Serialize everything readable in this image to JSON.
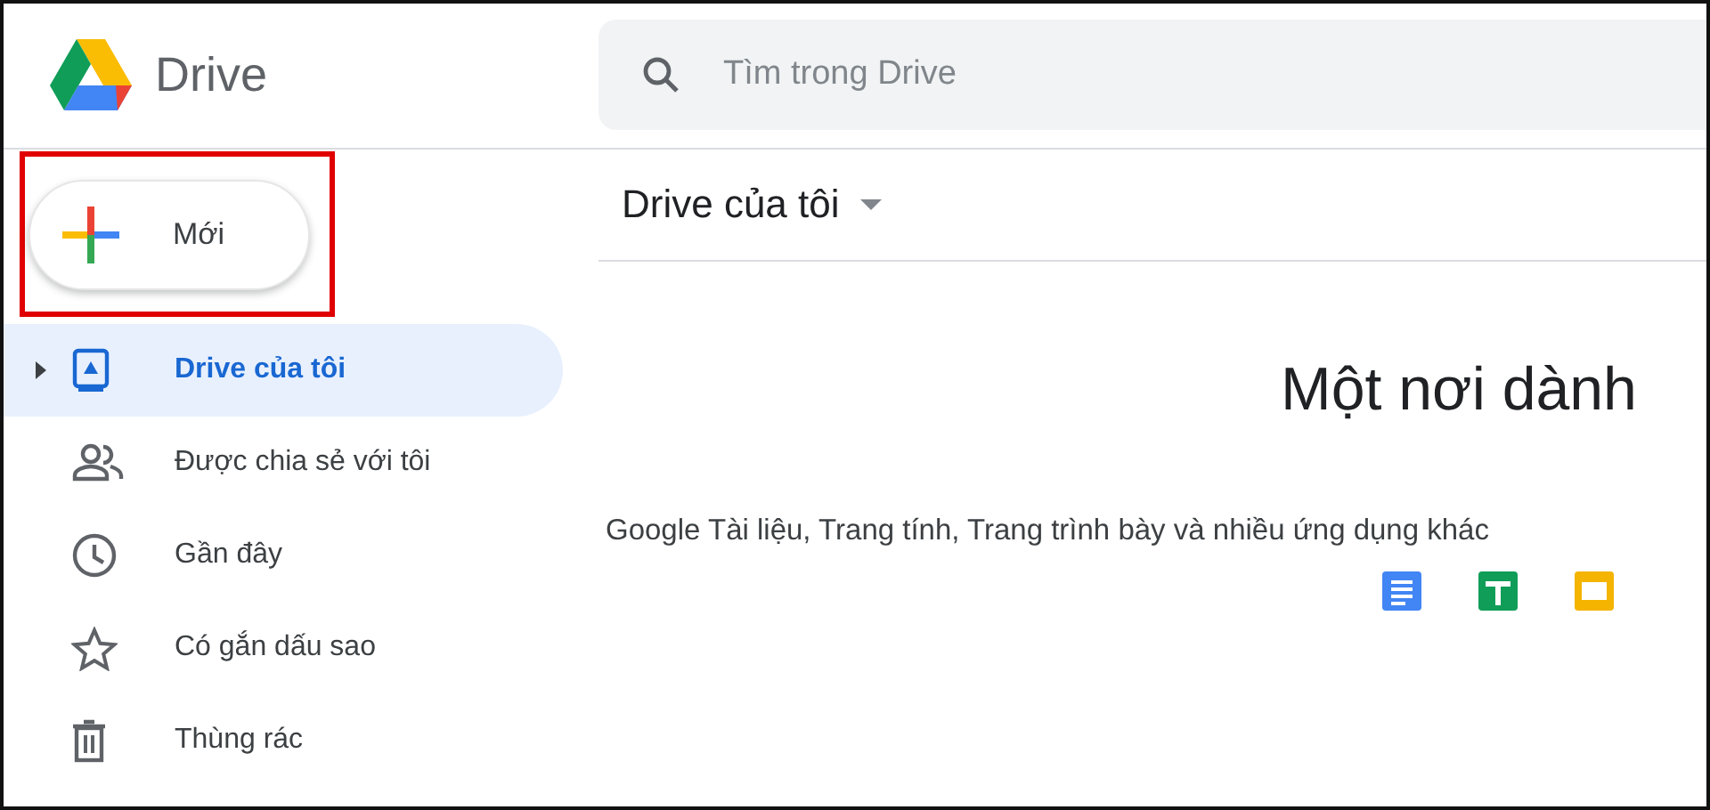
{
  "app": {
    "name": "Drive"
  },
  "search": {
    "placeholder": "Tìm trong Drive"
  },
  "new_button": {
    "label": "Mới",
    "highlighted": true
  },
  "sidebar": {
    "items": [
      {
        "kind": "drive",
        "label": "Drive của tôi",
        "selected": true,
        "expandable": true
      },
      {
        "kind": "shared",
        "label": "Được chia sẻ với tôi",
        "selected": false
      },
      {
        "kind": "recent",
        "label": "Gần đây",
        "selected": false
      },
      {
        "kind": "starred",
        "label": "Có gắn dấu sao",
        "selected": false
      },
      {
        "kind": "trash",
        "label": "Thùng rác",
        "selected": false
      }
    ]
  },
  "main": {
    "title": "Drive của tôi",
    "heading": "Một nơi dành",
    "subtitle": "Google Tài liệu, Trang tính, Trang trình bày và nhiều ứng dụng khác",
    "apps": [
      {
        "kind": "docs"
      },
      {
        "kind": "sheets"
      },
      {
        "kind": "slides"
      }
    ]
  }
}
